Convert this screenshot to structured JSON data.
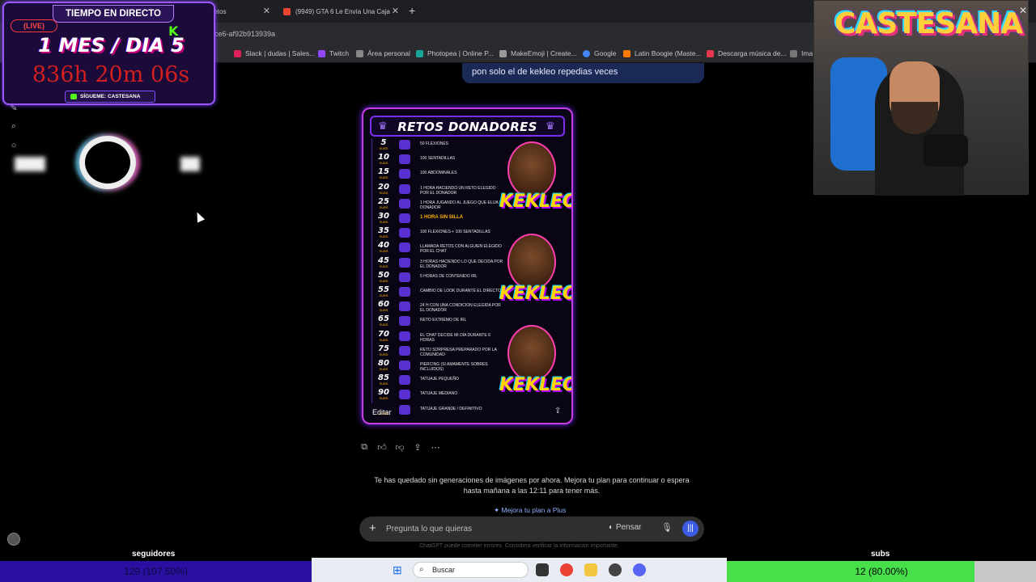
{
  "browser": {
    "tabs": [
      {
        "label": "e retos",
        "active": true
      },
      {
        "label": "(9949) GTA 6 Le Envía Una Caja"
      }
    ],
    "url": "ce6-af92b913939a",
    "bookmarks": [
      {
        "label": "Slack | dudas | Sales...",
        "color": "#e01e5a"
      },
      {
        "label": "Twitch",
        "color": "#9146ff"
      },
      {
        "label": "Área personal",
        "color": "#888888"
      },
      {
        "label": "Photopea | Online P...",
        "color": "#18a497"
      },
      {
        "label": "MakeEmoji | Create...",
        "color": "#999999"
      },
      {
        "label": "Google",
        "color": "#4285f4"
      },
      {
        "label": "Latin Boogie (Maste...",
        "color": "#ff7a00"
      },
      {
        "label": "Descarga música de...",
        "color": "#e8384f"
      },
      {
        "label": "Ima",
        "color": "#777777"
      }
    ]
  },
  "chat": {
    "user_message": "pon solo el de kekleo repedias veces",
    "poster": {
      "title": "RETOS DONADORES",
      "subs_label": "SUBS",
      "rows": [
        {
          "n": "5",
          "text": "50 FLEXIONES"
        },
        {
          "n": "10",
          "text": "100 SENTADILLAS"
        },
        {
          "n": "15",
          "text": "100 ABDOMINALES"
        },
        {
          "n": "20",
          "text": "1 HORA HACIENDO UN RETO ELEGIDO POR EL DONADOR"
        },
        {
          "n": "25",
          "text": "1 HORA JUGANDO AL JUEGO QUE ELIJA EL DONADOR"
        },
        {
          "n": "30",
          "text": "1 HORA SIN SILLA",
          "highlight": true
        },
        {
          "n": "35",
          "text": "100 FLEXIONES + 100 SENTADILLAS"
        },
        {
          "n": "40",
          "text": "LLAMADA RETOS CON ALGUIEN ELEGIDO POR EL CHAT"
        },
        {
          "n": "45",
          "text": "3 HORAS HACIENDO LO QUE DECIDA POR EL DONADOR"
        },
        {
          "n": "50",
          "text": "5 HORAS DE CONTENIDO IRL"
        },
        {
          "n": "55",
          "text": "CAMBIO DE LOOK DURANTE EL DIRECTO"
        },
        {
          "n": "60",
          "text": "24 H CON UNA CONDICION ELEGIDA POR EL DONADOR"
        },
        {
          "n": "65",
          "text": "RETO EXTREMO DE IRL"
        },
        {
          "n": "70",
          "text": "EL CHAT DECIDE MI DÍA DURANTE 6 HORAS"
        },
        {
          "n": "75",
          "text": "RETO SORPRESA PREPARADO POR LA COMUNIDAD"
        },
        {
          "n": "80",
          "text": "PIERCING (SI AMAMENTE SOBRES INCLUIDOS)"
        },
        {
          "n": "85",
          "text": "TATUAJE PEQUEÑO"
        },
        {
          "n": "90",
          "text": "TATUAJE MEDIANO"
        },
        {
          "n": "",
          "text": "TATUAJE GRANDE / DEFINITIVO"
        }
      ],
      "brand": "KEKLEO",
      "edit_label": "Editar"
    },
    "limit_message": "Te has quedado sin generaciones de imágenes por ahora. Mejora tu plan para continuar o espera hasta mañana a las 12:11 para tener más.",
    "upgrade_label": "Mejora tu plan a Plus",
    "prompt_placeholder": "Pregunta lo que quieras",
    "think_label": "Pensar",
    "disclaimer": "ChatGPT puede cometer errores. Considera verificar la información importante."
  },
  "overlay": {
    "header": "TIEMPO EN DIRECTO",
    "live": "(LIVE)",
    "kick": "K",
    "month_day": "1 MES / DIA 5",
    "countdown": "836h 20m 06s",
    "follow": "SÍGUEME: CASTESANA",
    "channel_banner": "CASTESANA",
    "followers_label": "seguidores",
    "followers_value": "129 (107.50%)",
    "followers_progress": 1.0,
    "subs_label": "subs",
    "subs_value": "12 (80.00%)",
    "subs_progress": 0.8
  },
  "taskbar": {
    "search_label": "Buscar",
    "apps": [
      {
        "name": "task-view",
        "color": "#333333"
      },
      {
        "name": "chrome",
        "color": "#e94235"
      },
      {
        "name": "file-explorer",
        "color": "#f4c542"
      },
      {
        "name": "obs",
        "color": "#444444"
      },
      {
        "name": "discord",
        "color": "#5865f2"
      }
    ]
  }
}
